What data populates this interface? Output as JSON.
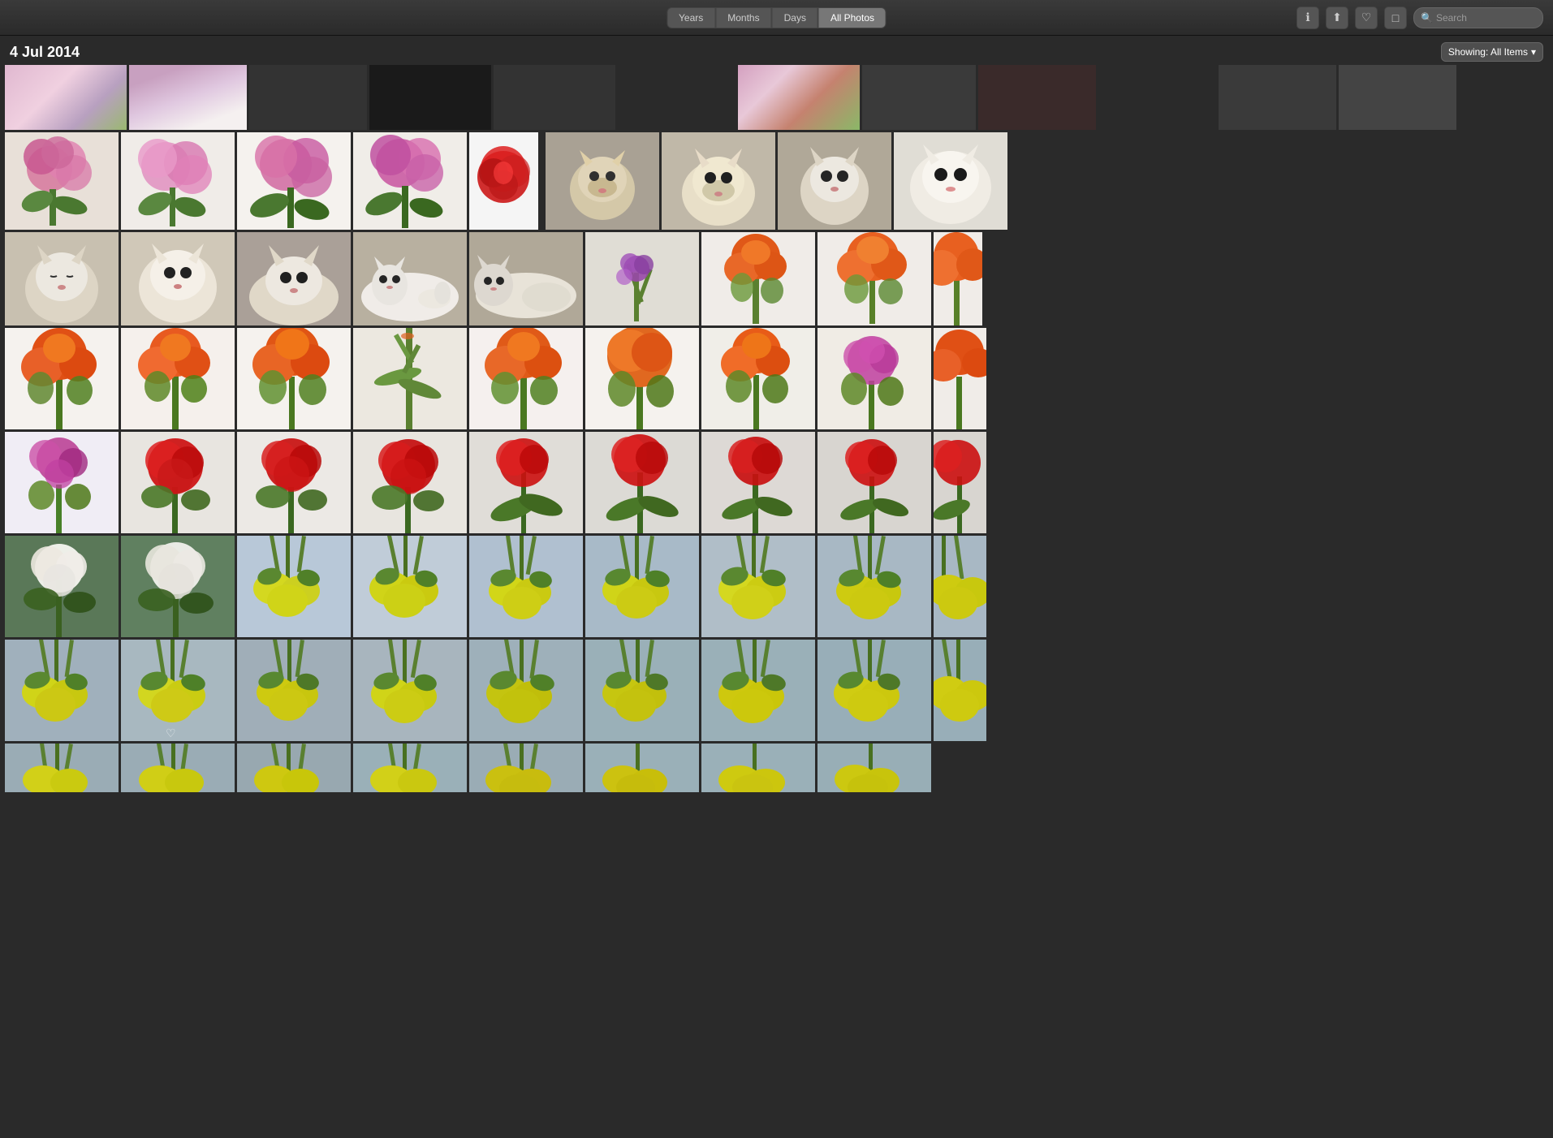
{
  "toolbar": {
    "tabs": [
      {
        "id": "years",
        "label": "Years",
        "active": false
      },
      {
        "id": "months",
        "label": "Months",
        "active": false
      },
      {
        "id": "days",
        "label": "Days",
        "active": false
      },
      {
        "id": "all_photos",
        "label": "All Photos",
        "active": true
      }
    ],
    "icons": {
      "info": "ℹ",
      "share": "⬆",
      "heart": "♡",
      "rotate": "⬜"
    },
    "search_placeholder": "Search",
    "showing_label": "Showing: All Items",
    "showing_chevron": "▾"
  },
  "date_label": "4 Jul 2014",
  "photo_types": {
    "pink_flowers": "Pink Hydrangea flowers",
    "red_flower": "Red flower close-up",
    "cats": "Cat photos",
    "orange_gladiolus": "Orange gladiolus",
    "roses": "Red roses",
    "white_roses": "White roses",
    "lemons": "Lemons on branch"
  }
}
